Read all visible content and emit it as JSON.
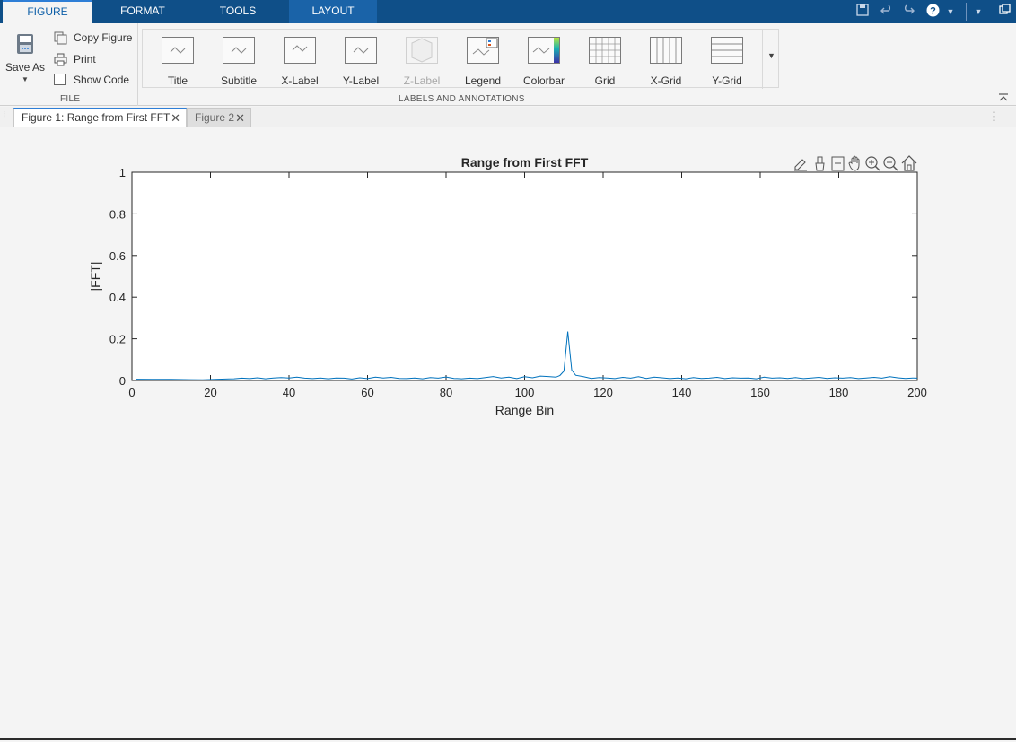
{
  "toolstrip": {
    "tabs": [
      "FIGURE",
      "FORMAT",
      "TOOLS",
      "LAYOUT"
    ],
    "active_tab": "FIGURE"
  },
  "quick_access": {
    "icons": [
      "save-icon",
      "undo-icon",
      "redo-icon",
      "help-icon",
      "help-dropdown-icon",
      "minimize-toolstrip-icon",
      "undock-icon"
    ]
  },
  "file_section": {
    "label": "FILE",
    "save_as_label": "Save As",
    "copy_figure_label": "Copy Figure",
    "print_label": "Print",
    "show_code_label": "Show Code"
  },
  "annotations_section": {
    "label": "LABELS AND ANNOTATIONS",
    "items": [
      {
        "label": "Title",
        "icon": "title-icon",
        "enabled": true
      },
      {
        "label": "Subtitle",
        "icon": "subtitle-icon",
        "enabled": true
      },
      {
        "label": "X-Label",
        "icon": "xlabel-icon",
        "enabled": true
      },
      {
        "label": "Y-Label",
        "icon": "ylabel-icon",
        "enabled": true
      },
      {
        "label": "Z-Label",
        "icon": "zlabel-icon",
        "enabled": false
      },
      {
        "label": "Legend",
        "icon": "legend-icon",
        "enabled": true
      },
      {
        "label": "Colorbar",
        "icon": "colorbar-icon",
        "enabled": true
      },
      {
        "label": "Grid",
        "icon": "grid-icon",
        "enabled": true
      },
      {
        "label": "X-Grid",
        "icon": "xgrid-icon",
        "enabled": true
      },
      {
        "label": "Y-Grid",
        "icon": "ygrid-icon",
        "enabled": true
      }
    ]
  },
  "figure_tabs": [
    {
      "label": "Figure 1: Range from First FFT",
      "active": true
    },
    {
      "label": "Figure 2",
      "active": false
    }
  ],
  "axes_toolbar": {
    "icons": [
      "edit-data-tips-icon",
      "brush-icon",
      "data-cursor-icon",
      "pan-icon",
      "zoom-in-icon",
      "zoom-out-icon",
      "home-icon"
    ]
  },
  "chart_data": {
    "type": "line",
    "title": "Range from First FFT",
    "xlabel": "Range Bin",
    "ylabel": "|FFT|",
    "xlim": [
      0,
      200
    ],
    "ylim": [
      0,
      1
    ],
    "xticks": [
      "0",
      "20",
      "40",
      "60",
      "80",
      "100",
      "120",
      "140",
      "160",
      "180",
      "200"
    ],
    "yticks": [
      "0",
      "0.2",
      "0.4",
      "0.6",
      "0.8",
      "1"
    ],
    "grid": false,
    "line_color": "#0072bd",
    "series": [
      {
        "x": [
          1,
          5,
          10,
          15,
          18,
          22,
          26,
          28,
          30,
          32,
          34,
          36,
          38,
          40,
          42,
          44,
          46,
          48,
          50,
          52,
          54,
          56,
          58,
          60,
          62,
          64,
          66,
          68,
          70,
          72,
          74,
          76,
          78,
          80,
          82,
          84,
          86,
          88,
          90,
          92,
          94,
          96,
          98,
          100,
          102,
          104,
          106,
          108,
          109,
          110,
          111,
          112,
          113,
          115,
          117,
          119,
          121,
          123,
          125,
          127,
          129,
          131,
          133,
          135,
          137,
          139,
          141,
          143,
          145,
          147,
          149,
          151,
          153,
          155,
          157,
          159,
          161,
          163,
          165,
          167,
          169,
          171,
          173,
          175,
          177,
          179,
          181,
          183,
          185,
          187,
          189,
          191,
          193,
          195,
          197,
          199,
          200
        ],
        "y": [
          0.006,
          0.005,
          0.005,
          0.004,
          0.003,
          0.006,
          0.008,
          0.011,
          0.009,
          0.013,
          0.008,
          0.012,
          0.014,
          0.012,
          0.016,
          0.011,
          0.009,
          0.012,
          0.008,
          0.012,
          0.011,
          0.007,
          0.013,
          0.009,
          0.016,
          0.012,
          0.015,
          0.01,
          0.009,
          0.012,
          0.008,
          0.014,
          0.011,
          0.017,
          0.01,
          0.008,
          0.011,
          0.009,
          0.014,
          0.019,
          0.012,
          0.016,
          0.009,
          0.018,
          0.013,
          0.021,
          0.019,
          0.016,
          0.024,
          0.045,
          0.235,
          0.05,
          0.025,
          0.018,
          0.01,
          0.014,
          0.012,
          0.009,
          0.015,
          0.011,
          0.018,
          0.01,
          0.016,
          0.013,
          0.009,
          0.012,
          0.008,
          0.014,
          0.01,
          0.011,
          0.015,
          0.009,
          0.013,
          0.011,
          0.012,
          0.008,
          0.016,
          0.011,
          0.013,
          0.01,
          0.014,
          0.009,
          0.012,
          0.015,
          0.01,
          0.013,
          0.011,
          0.014,
          0.009,
          0.012,
          0.015,
          0.011,
          0.018,
          0.013,
          0.01,
          0.012,
          0.011
        ]
      }
    ]
  }
}
